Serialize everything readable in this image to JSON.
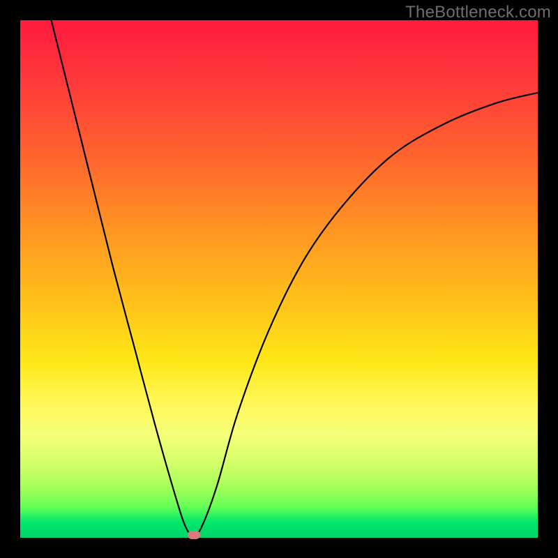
{
  "watermark": "TheBottleneck.com",
  "chart_data": {
    "type": "line",
    "title": "",
    "xlabel": "",
    "ylabel": "",
    "xlim": [
      0,
      100
    ],
    "ylim": [
      0,
      100
    ],
    "grid": false,
    "legend": false,
    "series": [
      {
        "name": "bottleneck-curve",
        "x": [
          6,
          10,
          14,
          18,
          22,
          26,
          30,
          32,
          33.5,
          35,
          38,
          42,
          48,
          55,
          63,
          72,
          82,
          92,
          100
        ],
        "y": [
          100,
          84,
          68,
          52,
          37,
          22,
          8,
          2,
          0.5,
          2,
          10,
          24,
          40,
          54,
          65,
          74,
          80,
          84,
          86
        ]
      }
    ],
    "marker": {
      "x": 33.5,
      "y": 0.5,
      "color": "#d97a7a"
    },
    "gradient_stops": [
      {
        "pos": 0,
        "color": "#ff1a3f"
      },
      {
        "pos": 12,
        "color": "#ff3a3a"
      },
      {
        "pos": 28,
        "color": "#ff6a2d"
      },
      {
        "pos": 42,
        "color": "#ff9a22"
      },
      {
        "pos": 56,
        "color": "#ffc61a"
      },
      {
        "pos": 66,
        "color": "#ffe818"
      },
      {
        "pos": 74,
        "color": "#fff85a"
      },
      {
        "pos": 80,
        "color": "#f6ff7a"
      },
      {
        "pos": 85,
        "color": "#d8ff6a"
      },
      {
        "pos": 90,
        "color": "#a8ff5a"
      },
      {
        "pos": 94,
        "color": "#66ff55"
      },
      {
        "pos": 97,
        "color": "#00e86a"
      },
      {
        "pos": 100,
        "color": "#00d36a"
      }
    ]
  }
}
